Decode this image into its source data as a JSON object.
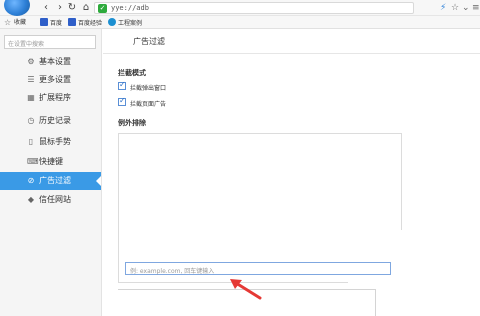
{
  "browser": {
    "url": "yye://adb",
    "icons": [
      "back-icon",
      "forward-icon",
      "reload-icon",
      "home-icon",
      "shield-icon",
      "star-icon",
      "menu-icon"
    ]
  },
  "bookmarks": {
    "favorites_label": "收藏",
    "items": [
      {
        "label": "百度"
      },
      {
        "label": "百度经验"
      },
      {
        "label": "工程案例"
      }
    ]
  },
  "sidebar": {
    "search_placeholder": "在设置中搜索",
    "items": [
      {
        "label": "基本设置",
        "icon": "gear-icon"
      },
      {
        "label": "更多设置",
        "icon": "list-icon"
      },
      {
        "label": "扩展程序",
        "icon": "grid-icon"
      },
      {
        "label": "历史记录",
        "icon": "clock-icon"
      },
      {
        "label": "鼠标手势",
        "icon": "mouse-icon"
      },
      {
        "label": "快捷键",
        "icon": "keyboard-icon"
      },
      {
        "label": "广告过滤",
        "icon": "block-icon",
        "active": true
      },
      {
        "label": "信任网站",
        "icon": "shield-trust-icon"
      }
    ]
  },
  "main": {
    "title": "广告过滤",
    "block_mode": {
      "title": "拦截模式",
      "options": [
        {
          "label": "拦截弹出窗口",
          "checked": true
        },
        {
          "label": "拦截页面广告",
          "checked": true
        }
      ]
    },
    "exceptions": {
      "title": "例外排除",
      "input_placeholder": "例: example.com, 回车键输入"
    }
  },
  "colors": {
    "accent": "#3a9ae6",
    "annotation_arrow": "#e53935"
  }
}
